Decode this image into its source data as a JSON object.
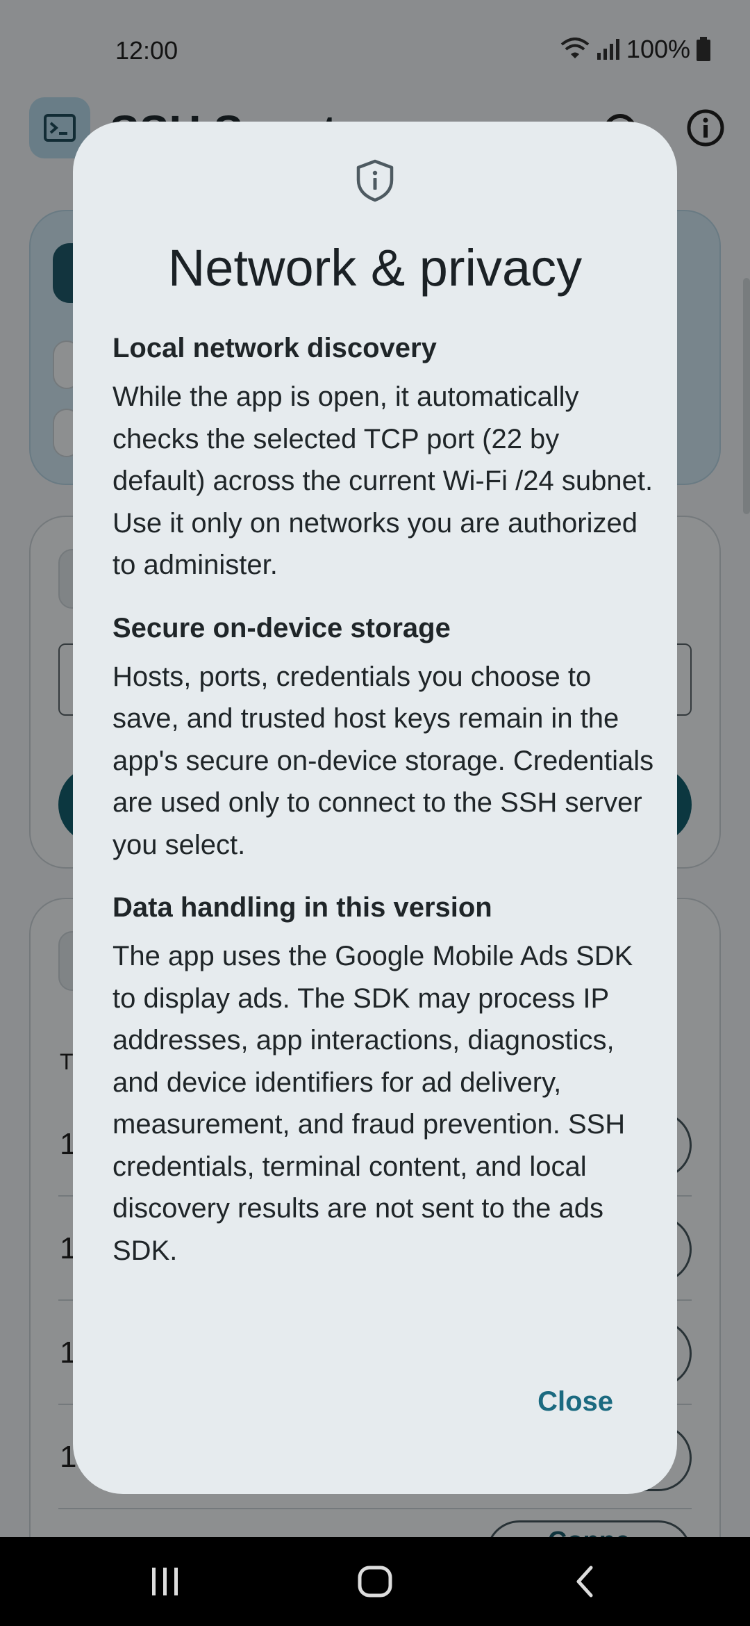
{
  "status_bar": {
    "time": "12:00",
    "battery": "100%"
  },
  "app_bar": {
    "title": "SSH Scout",
    "icons": [
      "terminal-icon",
      "gear-icon",
      "info-icon"
    ]
  },
  "background": {
    "table_header_fragment": "T",
    "row_numbers": [
      "1",
      "1",
      "1",
      "1"
    ],
    "connect_fragment": "Conne"
  },
  "dialog": {
    "icon": "shield-info-icon",
    "title": "Network & privacy",
    "sections": [
      {
        "heading": "Local network discovery",
        "body": "While the app is open, it automatically checks the selected TCP port (22 by default) across the current Wi-Fi /24 subnet. Use it only on networks you are authorized to administer."
      },
      {
        "heading": "Secure on-device storage",
        "body": "Hosts, ports, credentials you choose to save, and trusted host keys remain in the app's secure on-device storage. Credentials are used only to connect to the SSH server you select."
      },
      {
        "heading": "Data handling in this version",
        "body": "The app uses the Google Mobile Ads SDK to display ads. The SDK may process IP addresses, app interactions, diagnostics, and device identifiers for ad delivery, measurement, and fraud prevention. SSH credentials, terminal content, and local discovery results are not sent to the ads SDK."
      }
    ],
    "close_label": "Close"
  },
  "nav_bar": {
    "buttons": [
      "recents-icon",
      "home-icon",
      "back-icon"
    ]
  },
  "colors": {
    "accent": "#1b6a80",
    "dialog_bg": "#e6ebee",
    "scrim": "#000000"
  }
}
